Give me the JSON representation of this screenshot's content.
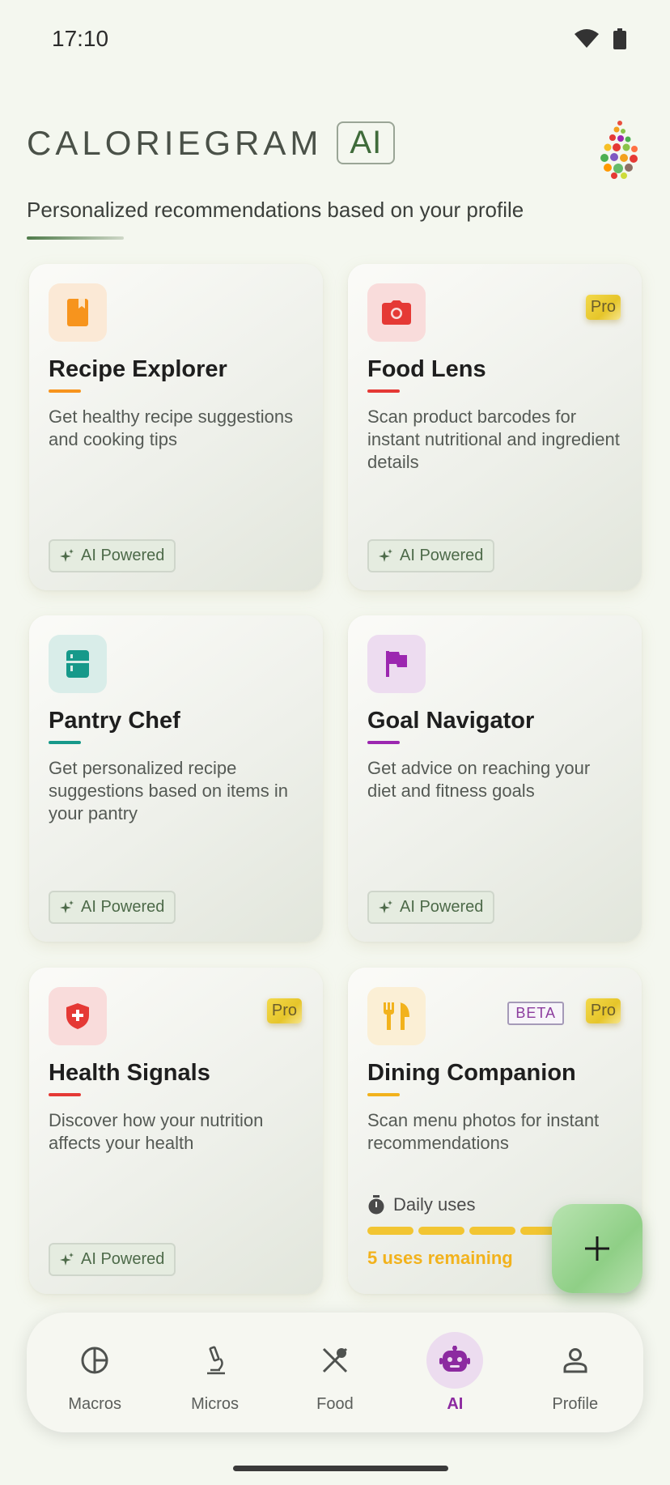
{
  "status": {
    "time": "17:10"
  },
  "header": {
    "brand": "CALORIEGRAM",
    "badge": "AI",
    "subtitle": "Personalized recommendations based on your profile"
  },
  "cards": [
    {
      "title": "Recipe Explorer",
      "desc": "Get healthy recipe suggestions and cooking tips",
      "chip": "AI Powered",
      "icon": "book-icon",
      "accent": "#f7941d",
      "icon_bg": "#fbe9d6"
    },
    {
      "title": "Food Lens",
      "desc": "Scan product barcodes for instant nutritional and ingredient details",
      "chip": "AI Powered",
      "badge": "Pro",
      "icon": "camera-icon",
      "accent": "#e53935",
      "icon_bg": "#f9dcdb"
    },
    {
      "title": "Pantry Chef",
      "desc": "Get personalized recipe suggestions based on items in your pantry",
      "chip": "AI Powered",
      "icon": "fridge-icon",
      "accent": "#16998a",
      "icon_bg": "#d9ede9"
    },
    {
      "title": "Goal Navigator",
      "desc": "Get advice on reaching your diet and fitness goals",
      "chip": "AI Powered",
      "icon": "flag-icon",
      "accent": "#9c27b0",
      "icon_bg": "#eddcf0"
    },
    {
      "title": "Health Signals",
      "desc": "Discover how your nutrition affects your health",
      "chip": "AI Powered",
      "badge": "Pro",
      "icon": "shield-plus-icon",
      "accent": "#e53935",
      "icon_bg": "#f9dcdb"
    },
    {
      "title": "Dining Companion",
      "desc": "Scan menu photos for instant recommendations",
      "badge": "Pro",
      "beta": "BETA",
      "daily_label": "Daily uses",
      "remaining": "5 uses remaining",
      "icon": "fork-knife-icon",
      "accent": "#f2b21c",
      "icon_bg": "#fbefd5"
    }
  ],
  "nav": {
    "items": [
      {
        "label": "Macros",
        "icon": "pie-chart-icon"
      },
      {
        "label": "Micros",
        "icon": "microscope-icon"
      },
      {
        "label": "Food",
        "icon": "utensils-icon"
      },
      {
        "label": "AI",
        "icon": "robot-icon",
        "active": true
      },
      {
        "label": "Profile",
        "icon": "person-icon"
      }
    ]
  }
}
